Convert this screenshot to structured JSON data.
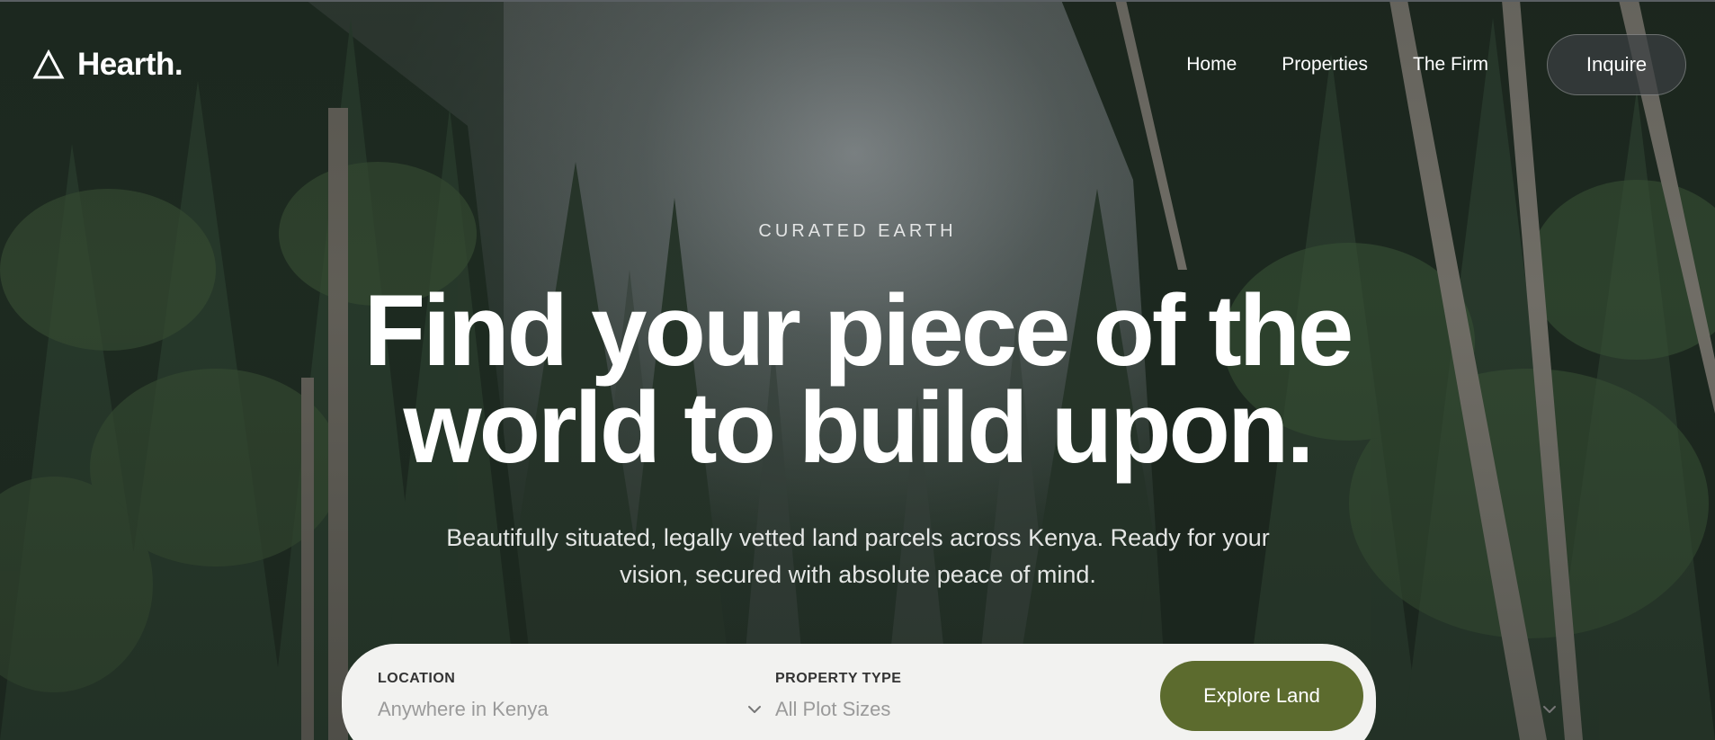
{
  "brand": {
    "name": "Hearth.",
    "logo_icon": "triangle-outline-icon"
  },
  "nav": {
    "links": [
      {
        "label": "Home"
      },
      {
        "label": "Properties"
      },
      {
        "label": "The Firm"
      }
    ],
    "cta_label": "Inquire"
  },
  "hero": {
    "eyebrow": "CURATED EARTH",
    "headline_line1": "Find your piece of the",
    "headline_line2": "world to build upon.",
    "subcopy_line1": "Beautifully situated, legally vetted land parcels across Kenya. Ready for your",
    "subcopy_line2": "vision, secured with absolute peace of mind."
  },
  "search": {
    "location_label": "LOCATION",
    "location_value": "Anywhere in Kenya",
    "type_label": "PROPERTY TYPE",
    "type_value": "All Plot Sizes",
    "submit_label": "Explore Land"
  },
  "colors": {
    "accent": "#5c6b2e",
    "search_bg": "#f2f2f0",
    "text_light": "#ffffff"
  }
}
